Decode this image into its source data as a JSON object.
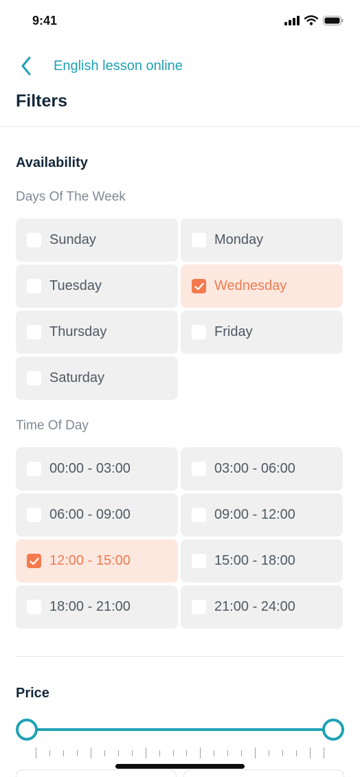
{
  "status_bar": {
    "time": "9:41",
    "icons": [
      "cellular-signal-icon",
      "wifi-icon",
      "battery-icon"
    ]
  },
  "nav": {
    "back_icon": "chevron-left-icon",
    "title": "English lesson online"
  },
  "page": {
    "title": "Filters"
  },
  "availability": {
    "title": "Availability",
    "days_label": "Days Of The Week",
    "days": [
      {
        "label": "Sunday",
        "checked": false
      },
      {
        "label": "Monday",
        "checked": false
      },
      {
        "label": "Tuesday",
        "checked": false
      },
      {
        "label": "Wednesday",
        "checked": true
      },
      {
        "label": "Thursday",
        "checked": false
      },
      {
        "label": "Friday",
        "checked": false
      },
      {
        "label": "Saturday",
        "checked": false
      }
    ],
    "time_label": "Time Of Day",
    "times": [
      {
        "label": "00:00 - 03:00",
        "checked": false
      },
      {
        "label": "03:00 - 06:00",
        "checked": false
      },
      {
        "label": "06:00 - 09:00",
        "checked": false
      },
      {
        "label": "09:00 - 12:00",
        "checked": false
      },
      {
        "label": "12:00 - 15:00",
        "checked": true
      },
      {
        "label": "15:00 - 18:00",
        "checked": false
      },
      {
        "label": "18:00 - 21:00",
        "checked": false
      },
      {
        "label": "21:00 - 24:00",
        "checked": false
      }
    ]
  },
  "price": {
    "title": "Price",
    "range_min_fraction": 0,
    "range_max_fraction": 1
  },
  "colors": {
    "accent": "#1fa1b5",
    "selected": "#f47a4d",
    "selected_background": "#fde8e0",
    "tile_background": "#f0f0f0",
    "heading": "#14283a"
  }
}
